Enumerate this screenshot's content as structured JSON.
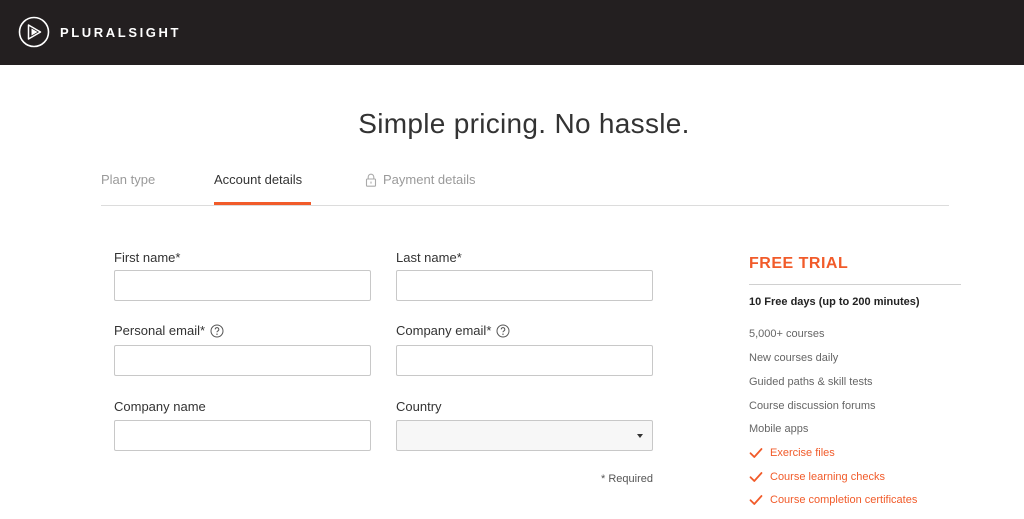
{
  "brand": {
    "name": "PLURALSIGHT",
    "accent": "#f15b2a",
    "topbar_color": "#231f20"
  },
  "headline": "Simple pricing. No hassle.",
  "tabs": [
    {
      "label": "Plan type",
      "state": "inactive"
    },
    {
      "label": "Account details",
      "state": "active"
    },
    {
      "label": "Payment details",
      "state": "locked",
      "icon": "lock-icon"
    }
  ],
  "form": {
    "first_name": {
      "label": "First name*",
      "value": "",
      "placeholder": ""
    },
    "last_name": {
      "label": "Last name*",
      "value": "",
      "placeholder": ""
    },
    "personal_email": {
      "label": "Personal email*",
      "value": "",
      "placeholder": "",
      "icon": "help-icon"
    },
    "company_email": {
      "label": "Company email*",
      "value": "",
      "placeholder": "",
      "icon": "help-icon"
    },
    "company_name": {
      "label": "Company name",
      "value": "",
      "placeholder": ""
    },
    "country": {
      "label": "Country",
      "selected": ""
    },
    "required_note": "* Required"
  },
  "trial": {
    "title": "FREE TRIAL",
    "subtitle": "10 Free days (up to 200 minutes)",
    "features": [
      "5,000+ courses",
      "New courses daily",
      "Guided paths & skill tests",
      "Course discussion forums",
      "Mobile apps"
    ],
    "extras": [
      {
        "label": "Exercise files",
        "icon": "check-icon"
      },
      {
        "label": "Course learning checks",
        "icon": "check-icon"
      },
      {
        "label": "Course completion certificates",
        "icon": "check-icon"
      }
    ]
  }
}
